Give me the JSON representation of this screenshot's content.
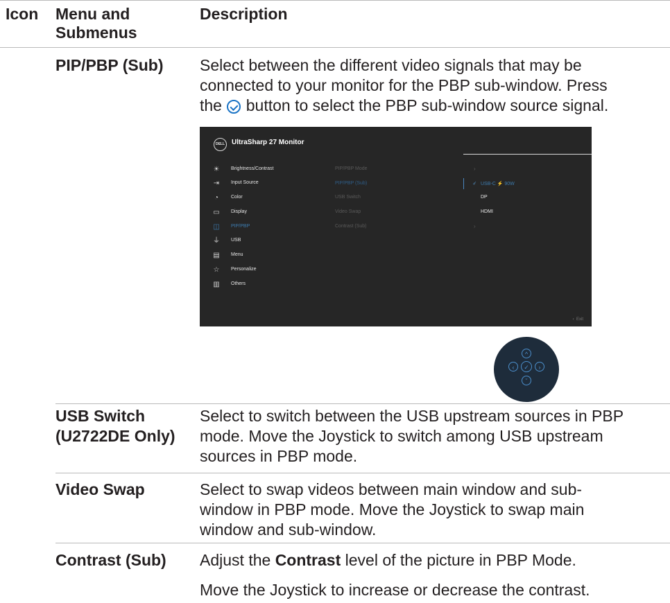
{
  "header": {
    "col_icon": "Icon",
    "col_menu_line1": "Menu and",
    "col_menu_line2": "Submenus",
    "col_desc": "Description"
  },
  "rows": [
    {
      "label": "PIP/PBP (Sub)",
      "desc_line1": "Select between the different video signals that may be",
      "desc_line2": "connected to your monitor for the PBP sub-window. Press",
      "desc_line3_pre": "the",
      "desc_line3_post": "button to select the PBP sub-window source signal."
    },
    {
      "label_line1": "USB Switch",
      "label_line2": "(U2722DE Only)",
      "desc_line1": "Select to switch between the USB upstream sources in PBP",
      "desc_line2": "mode. Move the Joystick to switch among USB upstream",
      "desc_line3": "sources in PBP mode."
    },
    {
      "label": "Video Swap",
      "desc_line1": "Select to swap videos between main window and sub-",
      "desc_line2": "window in PBP mode. Move the Joystick to swap main",
      "desc_line3": "window and sub-window."
    },
    {
      "label": "Contrast (Sub)",
      "desc_pre": "Adjust the",
      "desc_bold": "Contrast",
      "desc_post": "level of the picture in PBP Mode.",
      "desc_line2": "Move the Joystick to increase or decrease the contrast."
    }
  ],
  "osd": {
    "logo": "DELL",
    "title": "UltraSharp 27 Monitor",
    "menu": [
      {
        "icon": "brightness-icon",
        "glyph": "☀",
        "label": "Brightness/Contrast"
      },
      {
        "icon": "input-source-icon",
        "glyph": "⇥",
        "label": "Input Source"
      },
      {
        "icon": "color-icon",
        "glyph": "◔",
        "label": "Color"
      },
      {
        "icon": "display-icon",
        "glyph": "▭",
        "label": "Display"
      },
      {
        "icon": "pip-pbp-icon",
        "glyph": "◫",
        "label": "PIP/PBP"
      },
      {
        "icon": "usb-icon",
        "glyph": "⏚",
        "label": "USB"
      },
      {
        "icon": "menu-icon",
        "glyph": "▤",
        "label": "Menu"
      },
      {
        "icon": "star-icon",
        "glyph": "☆",
        "label": "Personalize"
      },
      {
        "icon": "others-icon",
        "glyph": "▥",
        "label": "Others"
      }
    ],
    "submenu": [
      "PIP/PBP Mode",
      "PIP/PBP (Sub)",
      "USB Switch",
      "Video Swap",
      "Contrast (Sub)"
    ],
    "options": [
      "USB-C ⚡ 90W",
      "DP",
      "HDMI"
    ],
    "exit": "Exit",
    "accent_color": "#3d7cb0"
  }
}
